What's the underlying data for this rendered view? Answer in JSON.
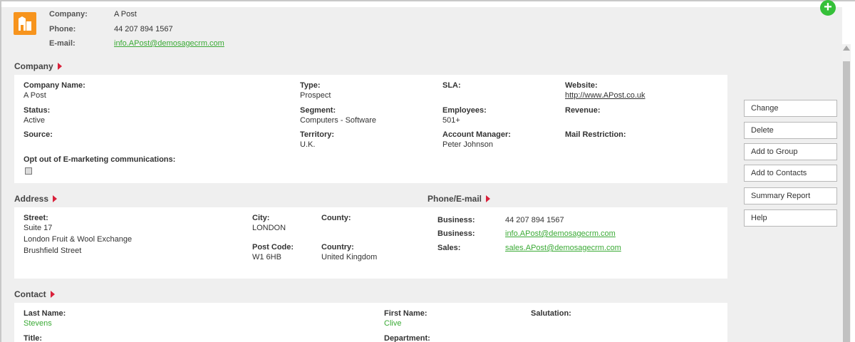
{
  "header": {
    "company_label": "Company:",
    "company_value": "A Post",
    "phone_label": "Phone:",
    "phone_value": "44 207 894 1567",
    "email_label": "E-mail:",
    "email_value": "info.APost@demosagecrm.com"
  },
  "add_icon": "+",
  "company": {
    "title": "Company",
    "fields": {
      "company_name_label": "Company Name:",
      "company_name_value": "A Post",
      "type_label": "Type:",
      "type_value": "Prospect",
      "sla_label": "SLA:",
      "website_label": "Website:",
      "website_value": "http://www.APost.co.uk",
      "status_label": "Status:",
      "status_value": "Active",
      "segment_label": "Segment:",
      "segment_value": "Computers - Software",
      "employees_label": "Employees:",
      "employees_value": "501+",
      "revenue_label": "Revenue:",
      "source_label": "Source:",
      "territory_label": "Territory:",
      "territory_value": "U.K.",
      "account_manager_label": "Account Manager:",
      "account_manager_value": "Peter Johnson",
      "mail_restriction_label": "Mail Restriction:",
      "opt_out_label": "Opt out of E-marketing communications:"
    }
  },
  "address": {
    "title": "Address",
    "street_label": "Street:",
    "street_line1": "Suite 17",
    "street_line2": "London Fruit & Wool Exchange",
    "street_line3": "Brushfield Street",
    "city_label": "City:",
    "city_value": "LONDON",
    "county_label": "County:",
    "post_code_label": "Post Code:",
    "post_code_value": "W1 6HB",
    "country_label": "Country:",
    "country_value": "United Kingdom"
  },
  "phone_email": {
    "title": "Phone/E-mail",
    "rows": [
      {
        "label": "Business:",
        "value": "44 207 894 1567"
      },
      {
        "label": "Business:",
        "value": "info.APost@demosagecrm.com"
      },
      {
        "label": "Sales:",
        "value": "sales.APost@demosagecrm.com"
      }
    ]
  },
  "contact": {
    "title": "Contact",
    "last_name_label": "Last Name:",
    "last_name_value": "Stevens",
    "first_name_label": "First Name:",
    "first_name_value": "Clive",
    "salutation_label": "Salutation:",
    "title_label": "Title:",
    "department_label": "Department:"
  },
  "actions": {
    "change": "Change",
    "delete": "Delete",
    "add_to_group": "Add to Group",
    "add_to_contacts": "Add to Contacts",
    "summary_report": "Summary Report",
    "help": "Help"
  },
  "colors": {
    "accent_green": "#3aaa35",
    "section_arrow": "#d9213b",
    "logo_orange": "#f7941d",
    "add_button": "#35c039"
  }
}
